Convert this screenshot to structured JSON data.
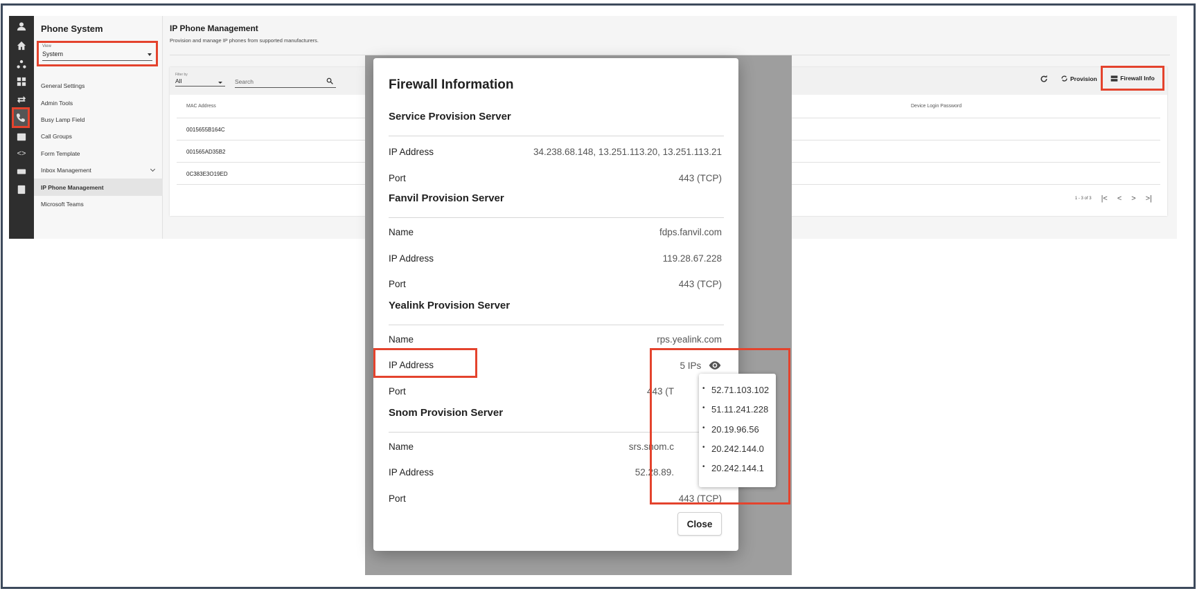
{
  "sidebar": {
    "title": "Phone System",
    "view_label": "View",
    "view_value": "System",
    "items": [
      {
        "label": "General Settings"
      },
      {
        "label": "Admin Tools"
      },
      {
        "label": "Busy Lamp Field"
      },
      {
        "label": "Call Groups"
      },
      {
        "label": "Form Template"
      },
      {
        "label": "Inbox Management"
      },
      {
        "label": "IP Phone Management"
      },
      {
        "label": "Microsoft Teams"
      }
    ]
  },
  "rail_icons": [
    "person-icon",
    "home-icon",
    "org-icon",
    "dashboard-icon",
    "transfer-icon",
    "phone-icon",
    "fax-icon",
    "code-icon",
    "sip-icon",
    "contact-icon"
  ],
  "main": {
    "title": "IP Phone Management",
    "subtitle": "Provision and manage IP phones from supported manufacturers.",
    "filter_label": "Filter by",
    "filter_value": "All",
    "search_placeholder": "Search",
    "provision_label": "Provision",
    "firewall_label": "Firewall Info",
    "columns": [
      "MAC Address",
      "Device Login Password"
    ],
    "rows": [
      "0015655B164C",
      "001565AD35B2",
      "0C383E3O19ED"
    ],
    "pagination": "1 - 3 of 3"
  },
  "dialog": {
    "title": "Firewall Information",
    "close_label": "Close",
    "sections": [
      {
        "title": "Service Provision Server",
        "rows": [
          {
            "key": "IP Address",
            "value": "34.238.68.148, 13.251.113.20, 13.251.113.21"
          },
          {
            "key": "Port",
            "value": "443 (TCP)"
          }
        ]
      },
      {
        "title": "Fanvil Provision Server",
        "rows": [
          {
            "key": "Name",
            "value": "fdps.fanvil.com"
          },
          {
            "key": "IP Address",
            "value": "119.28.67.228"
          },
          {
            "key": "Port",
            "value": "443 (TCP)"
          }
        ]
      },
      {
        "title": "Yealink Provision Server",
        "rows": [
          {
            "key": "Name",
            "value": "rps.yealink.com"
          },
          {
            "key": "IP Address",
            "value": "5 IPs"
          },
          {
            "key": "Port",
            "value": "443 (T"
          }
        ]
      },
      {
        "title": "Snom Provision Server",
        "rows": [
          {
            "key": "Name",
            "value": "srs.snom.c"
          },
          {
            "key": "IP Address",
            "value": "52.28.89."
          },
          {
            "key": "Port",
            "value": "443 (TCP)"
          }
        ]
      }
    ],
    "yealink_ips": [
      "52.71.103.102",
      "51.11.241.228",
      "20.19.96.56",
      "20.242.144.0",
      "20.242.144.1"
    ]
  },
  "colors": {
    "highlight": "#e4432d",
    "rail": "#2e2e2e",
    "backdrop": "#9e9e9e"
  }
}
